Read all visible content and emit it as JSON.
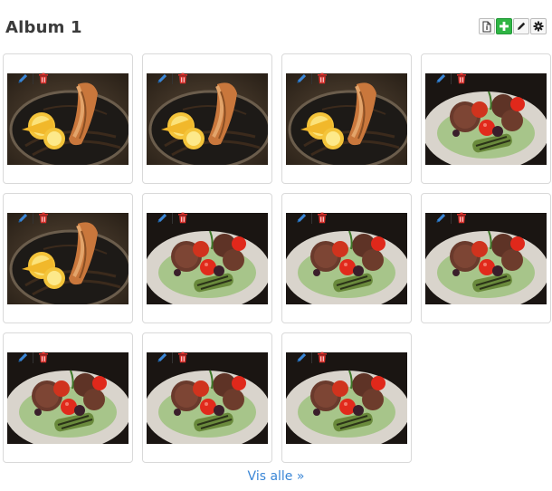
{
  "album": {
    "title": "Album 1"
  },
  "toolbar": {
    "buttons": [
      "info-icon",
      "plus-icon",
      "pencil-icon",
      "gear-icon"
    ]
  },
  "colors": {
    "accent": "#3a86d6",
    "delete": "#d9302c",
    "add": "#2fb544"
  },
  "photos": [
    {
      "subject": "fish"
    },
    {
      "subject": "fish"
    },
    {
      "subject": "fish"
    },
    {
      "subject": "meatballs"
    },
    {
      "subject": "fish"
    },
    {
      "subject": "meatballs"
    },
    {
      "subject": "meatballs"
    },
    {
      "subject": "meatballs"
    },
    {
      "subject": "meatballs"
    },
    {
      "subject": "meatballs"
    },
    {
      "subject": "meatballs"
    }
  ],
  "footer": {
    "show_all_label": "Vis alle »"
  }
}
